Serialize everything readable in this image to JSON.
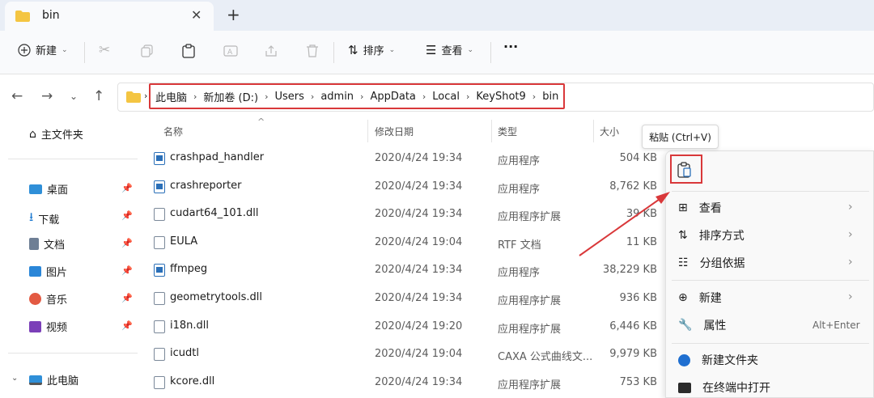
{
  "tab": {
    "title": "bin"
  },
  "toolbar": {
    "new_label": "新建",
    "sort_label": "排序",
    "view_label": "查看",
    "more_label": "···"
  },
  "breadcrumb": [
    "此电脑",
    "新加卷 (D:)",
    "Users",
    "admin",
    "AppData",
    "Local",
    "KeyShot9",
    "bin"
  ],
  "sidebar": {
    "home": "主文件夹",
    "items": [
      {
        "label": "桌面",
        "icon": "desktop-icon"
      },
      {
        "label": "下载",
        "icon": "download-icon"
      },
      {
        "label": "文档",
        "icon": "document-icon"
      },
      {
        "label": "图片",
        "icon": "pictures-icon"
      },
      {
        "label": "音乐",
        "icon": "music-icon"
      },
      {
        "label": "视频",
        "icon": "video-icon"
      }
    ],
    "this_pc": "此电脑"
  },
  "columns": {
    "name": "名称",
    "date": "修改日期",
    "type": "类型",
    "size": "大小"
  },
  "files": [
    {
      "name": "crashpad_handler",
      "date": "2020/4/24 19:34",
      "type": "应用程序",
      "size": "504 KB",
      "kind": "exe"
    },
    {
      "name": "crashreporter",
      "date": "2020/4/24 19:34",
      "type": "应用程序",
      "size": "8,762 KB",
      "kind": "exe"
    },
    {
      "name": "cudart64_101.dll",
      "date": "2020/4/24 19:34",
      "type": "应用程序扩展",
      "size": "39 KB",
      "kind": "dll"
    },
    {
      "name": "EULA",
      "date": "2020/4/24 19:04",
      "type": "RTF 文档",
      "size": "11 KB",
      "kind": "doc"
    },
    {
      "name": "ffmpeg",
      "date": "2020/4/24 19:34",
      "type": "应用程序",
      "size": "38,229 KB",
      "kind": "exe"
    },
    {
      "name": "geometrytools.dll",
      "date": "2020/4/24 19:34",
      "type": "应用程序扩展",
      "size": "936 KB",
      "kind": "dll"
    },
    {
      "name": "i18n.dll",
      "date": "2020/4/24 19:20",
      "type": "应用程序扩展",
      "size": "6,446 KB",
      "kind": "dll"
    },
    {
      "name": "icudtl",
      "date": "2020/4/24 19:04",
      "type": "CAXA 公式曲线文...",
      "size": "9,979 KB",
      "kind": "doc"
    },
    {
      "name": "kcore.dll",
      "date": "2020/4/24 19:34",
      "type": "应用程序扩展",
      "size": "753 KB",
      "kind": "dll"
    }
  ],
  "tooltip": "粘贴 (Ctrl+V)",
  "context_menu": {
    "view": "查看",
    "sort": "排序方式",
    "group": "分组依据",
    "new": "新建",
    "properties": "属性",
    "properties_key": "Alt+Enter",
    "new_folder": "新建文件夹",
    "terminal": "在终端中打开"
  },
  "colors": {
    "highlight": "#d9383a",
    "folder": "#f4c542",
    "accent": "#2a6fb8"
  }
}
